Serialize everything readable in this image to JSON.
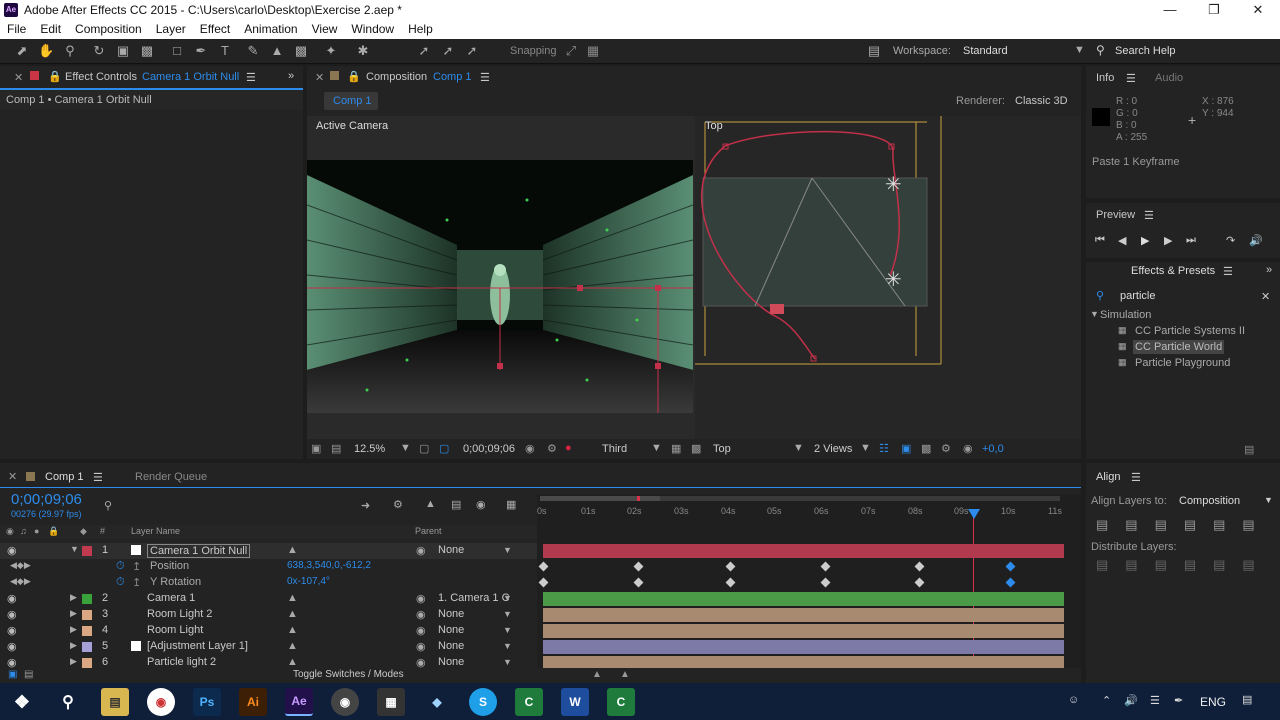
{
  "window": {
    "title": "Adobe After Effects CC 2015 - C:\\Users\\carlo\\Desktop\\Exercise 2.aep *",
    "logo": "Ae"
  },
  "menu": [
    "File",
    "Edit",
    "Composition",
    "Layer",
    "Effect",
    "Animation",
    "View",
    "Window",
    "Help"
  ],
  "toolbar": {
    "snapping": "Snapping",
    "workspace_label": "Workspace:",
    "workspace": "Standard",
    "search_help": "Search Help"
  },
  "effect_controls": {
    "tab": "Effect Controls",
    "tab_layer": "Camera 1 Orbit Null",
    "breadcrumb": "Comp 1 • Camera 1 Orbit Null"
  },
  "composition": {
    "tab": "Composition",
    "tab_name": "Comp 1",
    "comp_button": "Comp 1",
    "renderer_label": "Renderer:",
    "renderer": "Classic 3D",
    "active_camera": "Active Camera",
    "top_label": "Top",
    "zoom": "12.5%",
    "timecode": "0;00;09;06",
    "view_third": "Third",
    "view_top": "Top",
    "views": "2 Views",
    "exposure": "+0,0"
  },
  "info": {
    "tab": "Info",
    "tab_audio": "Audio",
    "r": "R : 0",
    "g": "G : 0",
    "b": "B : 0",
    "a": "A : 255",
    "x": "X : 876",
    "y": "Y : 944",
    "status": "Paste 1 Keyframe"
  },
  "preview": {
    "tab": "Preview"
  },
  "effects": {
    "tab": "Effects & Presets",
    "search": "particle",
    "category": "Simulation",
    "items": [
      "CC Particle Systems II",
      "CC Particle World",
      "Particle Playground"
    ]
  },
  "align": {
    "tab": "Align",
    "align_to_label": "Align Layers to:",
    "align_to": "Composition",
    "distribute": "Distribute Layers:"
  },
  "timeline": {
    "tab": "Comp 1",
    "render_queue": "Render Queue",
    "timecode": "0;00;09;06",
    "fps": "00276 (29.97 fps)",
    "col_layer": "Layer Name",
    "col_parent": "Parent",
    "hash": "#",
    "toggle": "Toggle Switches / Modes",
    "ruler": [
      "0s",
      "01s",
      "02s",
      "03s",
      "04s",
      "05s",
      "06s",
      "07s",
      "08s",
      "09s",
      "10s",
      "11s"
    ],
    "layers": [
      {
        "num": "1",
        "name": "Camera 1 Orbit Null",
        "parent": "None",
        "color": "#c23a4f",
        "bar": "#b23a4e"
      },
      {
        "num": "",
        "name": "Position",
        "value": "638,3,540,0,-612,2"
      },
      {
        "num": "",
        "name": "Y Rotation",
        "value": "0x-107,4°"
      },
      {
        "num": "2",
        "name": "Camera 1",
        "parent": "1. Camera 1 C",
        "color": "#3aa23a",
        "bar": "#4a9a48"
      },
      {
        "num": "3",
        "name": "Room Light 2",
        "parent": "None",
        "color": "#d9a882",
        "bar": "#a88a70"
      },
      {
        "num": "4",
        "name": "Room Light",
        "parent": "None",
        "color": "#d9a882",
        "bar": "#a88a70"
      },
      {
        "num": "5",
        "name": "[Adjustment Layer 1]",
        "parent": "None",
        "color": "#a5a0d8",
        "bar": "#7d7aa8"
      },
      {
        "num": "6",
        "name": "Particle light 2",
        "parent": "None",
        "color": "#d9a882",
        "bar": "#a88a70"
      }
    ]
  },
  "taskbar": {
    "lang": "ENG",
    "apps": [
      "Ps",
      "Ai",
      "Ae",
      "W"
    ]
  },
  "colors": {
    "accent": "#2d8ceb",
    "playhead": "#d8314a"
  }
}
